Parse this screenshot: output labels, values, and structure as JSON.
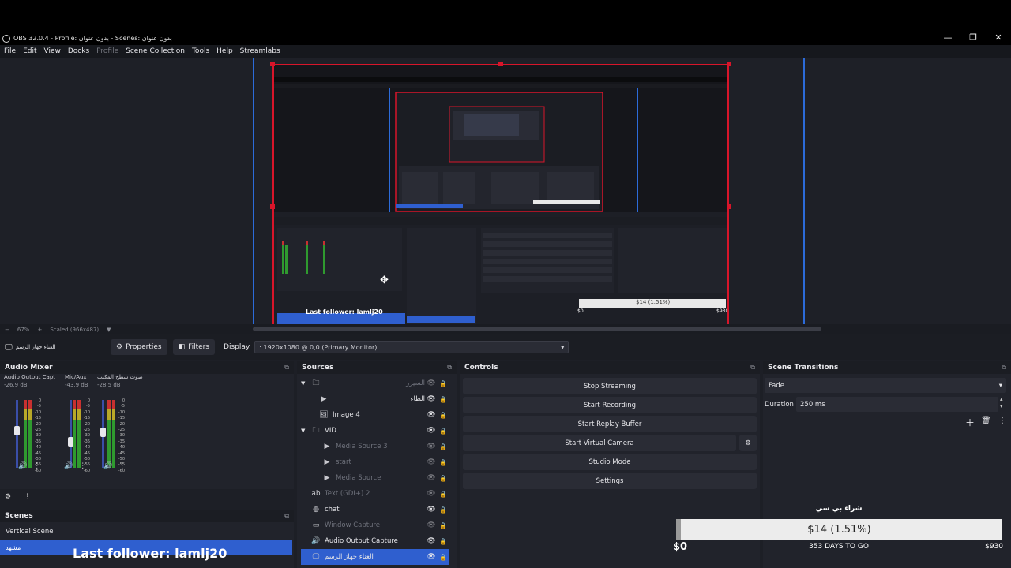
{
  "window": {
    "title": "OBS 32.0.4 - Profile: بدون عنوان - Scenes: بدون عنوان"
  },
  "menu": [
    "File",
    "Edit",
    "View",
    "Docks",
    "Profile",
    "Scene Collection",
    "Tools",
    "Help",
    "Streamlabs"
  ],
  "status": {
    "zoom": "67%",
    "scale": "Scaled (966x487)"
  },
  "preview": {
    "nested_follower": "Last follower: lamlj20",
    "nested_amount": "$14 (1.51%)",
    "nested_min": "$0",
    "nested_max": "$930"
  },
  "source_toolbar": {
    "selected_source": "الغناء جهاز الرسم",
    "properties_label": "Properties",
    "filters_label": "Filters",
    "display_label": "Display",
    "display_value": ": 1920x1080 @ 0,0 (Primary Monitor)"
  },
  "audio_mixer": {
    "title": "Audio Mixer",
    "channels": [
      {
        "name": "Audio Output Capt",
        "db": "-26.9 dB",
        "level": 0.55
      },
      {
        "name": "Mic/Aux",
        "db": "-43.9 dB",
        "level": 0.38
      },
      {
        "name": "صوت سطح المكتب",
        "db": "-28.5 dB",
        "level": 0.52
      }
    ],
    "scale": [
      "0",
      "-5",
      "-10",
      "-15",
      "-20",
      "-25",
      "-30",
      "-35",
      "-40",
      "-45",
      "-50",
      "-55",
      "-60"
    ]
  },
  "scenes": {
    "title": "Scenes",
    "items": [
      "Vertical Scene",
      "مشهد"
    ],
    "overlay": "Last follower: lamlj20"
  },
  "sources": {
    "title": "Sources",
    "items": [
      {
        "label": "السيرر",
        "icon": "folder",
        "arrow": "▼",
        "dim": true
      },
      {
        "label": "الطاء",
        "icon": "play",
        "arrow": "",
        "dim": false
      },
      {
        "label": "Image 4",
        "icon": "image",
        "arrow": "",
        "dim": false
      },
      {
        "label": "VID",
        "icon": "folder",
        "arrow": "▼",
        "dim": false
      },
      {
        "label": "Media Source 3",
        "icon": "play",
        "arrow": "",
        "dim": true
      },
      {
        "label": "start",
        "icon": "play",
        "arrow": "",
        "dim": true
      },
      {
        "label": "Media Source",
        "icon": "play",
        "arrow": "",
        "dim": true
      },
      {
        "label": "Text (GDI+) 2",
        "icon": "text",
        "arrow": "",
        "dim": true
      },
      {
        "label": "chat",
        "icon": "browser",
        "arrow": "",
        "dim": false
      },
      {
        "label": "Window Capture",
        "icon": "window",
        "arrow": "",
        "dim": true
      },
      {
        "label": "Audio Output Capture",
        "icon": "speaker",
        "arrow": "",
        "dim": false
      },
      {
        "label": "الغناء جهاز الرسم",
        "icon": "display",
        "arrow": "",
        "dim": false
      }
    ]
  },
  "controls": {
    "title": "Controls",
    "stop_streaming": "Stop Streaming",
    "start_recording": "Start Recording",
    "start_replay": "Start Replay Buffer",
    "start_virtual": "Start Virtual Camera",
    "studio_mode": "Studio Mode",
    "settings": "Settings"
  },
  "transitions": {
    "title": "Scene Transitions",
    "selected": "Fade",
    "duration_label": "Duration",
    "duration_value": "250 ms"
  },
  "goal": {
    "title": "شراء بي سي",
    "amount": "$14 (1.51%)",
    "min": "$0",
    "days": "353 DAYS TO GO",
    "max": "$930",
    "progress": 0.0151
  }
}
